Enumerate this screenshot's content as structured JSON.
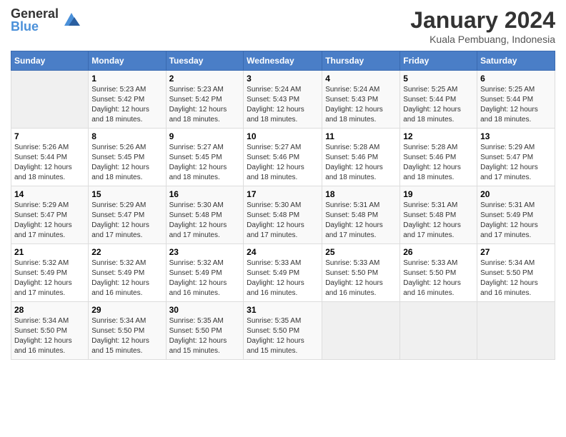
{
  "logo": {
    "general": "General",
    "blue": "Blue"
  },
  "header": {
    "month": "January 2024",
    "location": "Kuala Pembuang, Indonesia"
  },
  "days_of_week": [
    "Sunday",
    "Monday",
    "Tuesday",
    "Wednesday",
    "Thursday",
    "Friday",
    "Saturday"
  ],
  "weeks": [
    [
      {
        "day": "",
        "info": ""
      },
      {
        "day": "1",
        "info": "Sunrise: 5:23 AM\nSunset: 5:42 PM\nDaylight: 12 hours\nand 18 minutes."
      },
      {
        "day": "2",
        "info": "Sunrise: 5:23 AM\nSunset: 5:42 PM\nDaylight: 12 hours\nand 18 minutes."
      },
      {
        "day": "3",
        "info": "Sunrise: 5:24 AM\nSunset: 5:43 PM\nDaylight: 12 hours\nand 18 minutes."
      },
      {
        "day": "4",
        "info": "Sunrise: 5:24 AM\nSunset: 5:43 PM\nDaylight: 12 hours\nand 18 minutes."
      },
      {
        "day": "5",
        "info": "Sunrise: 5:25 AM\nSunset: 5:44 PM\nDaylight: 12 hours\nand 18 minutes."
      },
      {
        "day": "6",
        "info": "Sunrise: 5:25 AM\nSunset: 5:44 PM\nDaylight: 12 hours\nand 18 minutes."
      }
    ],
    [
      {
        "day": "7",
        "info": "Sunrise: 5:26 AM\nSunset: 5:44 PM\nDaylight: 12 hours\nand 18 minutes."
      },
      {
        "day": "8",
        "info": "Sunrise: 5:26 AM\nSunset: 5:45 PM\nDaylight: 12 hours\nand 18 minutes."
      },
      {
        "day": "9",
        "info": "Sunrise: 5:27 AM\nSunset: 5:45 PM\nDaylight: 12 hours\nand 18 minutes."
      },
      {
        "day": "10",
        "info": "Sunrise: 5:27 AM\nSunset: 5:46 PM\nDaylight: 12 hours\nand 18 minutes."
      },
      {
        "day": "11",
        "info": "Sunrise: 5:28 AM\nSunset: 5:46 PM\nDaylight: 12 hours\nand 18 minutes."
      },
      {
        "day": "12",
        "info": "Sunrise: 5:28 AM\nSunset: 5:46 PM\nDaylight: 12 hours\nand 18 minutes."
      },
      {
        "day": "13",
        "info": "Sunrise: 5:29 AM\nSunset: 5:47 PM\nDaylight: 12 hours\nand 17 minutes."
      }
    ],
    [
      {
        "day": "14",
        "info": "Sunrise: 5:29 AM\nSunset: 5:47 PM\nDaylight: 12 hours\nand 17 minutes."
      },
      {
        "day": "15",
        "info": "Sunrise: 5:29 AM\nSunset: 5:47 PM\nDaylight: 12 hours\nand 17 minutes."
      },
      {
        "day": "16",
        "info": "Sunrise: 5:30 AM\nSunset: 5:48 PM\nDaylight: 12 hours\nand 17 minutes."
      },
      {
        "day": "17",
        "info": "Sunrise: 5:30 AM\nSunset: 5:48 PM\nDaylight: 12 hours\nand 17 minutes."
      },
      {
        "day": "18",
        "info": "Sunrise: 5:31 AM\nSunset: 5:48 PM\nDaylight: 12 hours\nand 17 minutes."
      },
      {
        "day": "19",
        "info": "Sunrise: 5:31 AM\nSunset: 5:48 PM\nDaylight: 12 hours\nand 17 minutes."
      },
      {
        "day": "20",
        "info": "Sunrise: 5:31 AM\nSunset: 5:49 PM\nDaylight: 12 hours\nand 17 minutes."
      }
    ],
    [
      {
        "day": "21",
        "info": "Sunrise: 5:32 AM\nSunset: 5:49 PM\nDaylight: 12 hours\nand 17 minutes."
      },
      {
        "day": "22",
        "info": "Sunrise: 5:32 AM\nSunset: 5:49 PM\nDaylight: 12 hours\nand 16 minutes."
      },
      {
        "day": "23",
        "info": "Sunrise: 5:32 AM\nSunset: 5:49 PM\nDaylight: 12 hours\nand 16 minutes."
      },
      {
        "day": "24",
        "info": "Sunrise: 5:33 AM\nSunset: 5:49 PM\nDaylight: 12 hours\nand 16 minutes."
      },
      {
        "day": "25",
        "info": "Sunrise: 5:33 AM\nSunset: 5:50 PM\nDaylight: 12 hours\nand 16 minutes."
      },
      {
        "day": "26",
        "info": "Sunrise: 5:33 AM\nSunset: 5:50 PM\nDaylight: 12 hours\nand 16 minutes."
      },
      {
        "day": "27",
        "info": "Sunrise: 5:34 AM\nSunset: 5:50 PM\nDaylight: 12 hours\nand 16 minutes."
      }
    ],
    [
      {
        "day": "28",
        "info": "Sunrise: 5:34 AM\nSunset: 5:50 PM\nDaylight: 12 hours\nand 16 minutes."
      },
      {
        "day": "29",
        "info": "Sunrise: 5:34 AM\nSunset: 5:50 PM\nDaylight: 12 hours\nand 15 minutes."
      },
      {
        "day": "30",
        "info": "Sunrise: 5:35 AM\nSunset: 5:50 PM\nDaylight: 12 hours\nand 15 minutes."
      },
      {
        "day": "31",
        "info": "Sunrise: 5:35 AM\nSunset: 5:50 PM\nDaylight: 12 hours\nand 15 minutes."
      },
      {
        "day": "",
        "info": ""
      },
      {
        "day": "",
        "info": ""
      },
      {
        "day": "",
        "info": ""
      }
    ]
  ]
}
